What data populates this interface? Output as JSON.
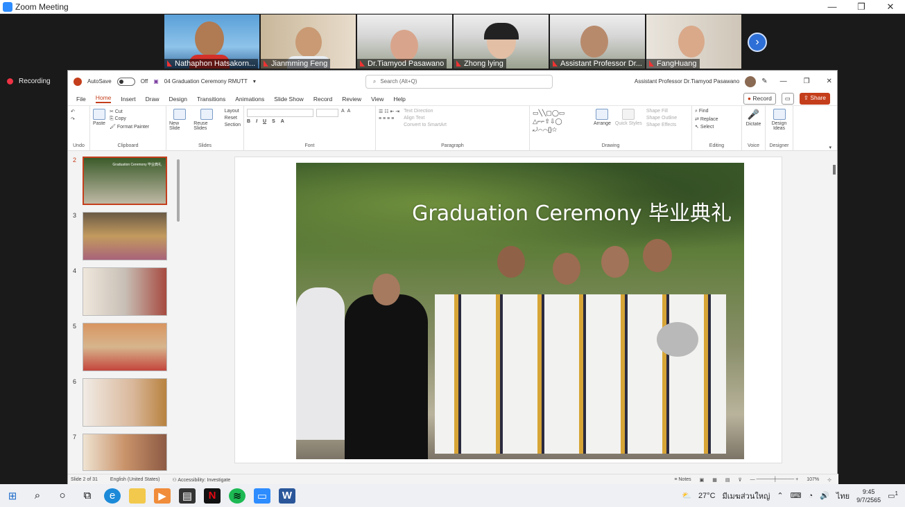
{
  "window": {
    "title": "Zoom Meeting",
    "controls": [
      "—",
      "❐",
      "✕"
    ]
  },
  "participants": [
    {
      "name": "Nathaphon Hatsakorn..."
    },
    {
      "name": "Jianmming Feng"
    },
    {
      "name": "Dr.Tiamyod Pasawano"
    },
    {
      "name": "Zhong lying"
    },
    {
      "name": "Assistant Professor Dr..."
    },
    {
      "name": "FangHuang"
    }
  ],
  "recording": {
    "label": "Recording"
  },
  "ppt": {
    "autosave": "AutoSave",
    "autosave_state": "Off",
    "filename": "04 Graduation Ceremony RMUTT",
    "search_placeholder": "Search (Alt+Q)",
    "user": "Assistant Professor Dr.Tiamyod Pasawano",
    "tabs": [
      "File",
      "Home",
      "Insert",
      "Draw",
      "Design",
      "Transitions",
      "Animations",
      "Slide Show",
      "Record",
      "Review",
      "View",
      "Help"
    ],
    "record_btn": "Record",
    "share_btn": "Share",
    "ribbon": {
      "cut": "Cut",
      "copy": "Copy",
      "format_painter": "Format Painter",
      "paste": "Paste",
      "new_slide": "New Slide",
      "reuse_slides": "Reuse Slides",
      "layout": "Layout",
      "reset": "Reset",
      "section": "Section",
      "text_direction": "Text Direction",
      "align_text": "Align Text",
      "convert_smartart": "Convert to SmartArt",
      "arrange": "Arrange",
      "quick_styles": "Quick Styles",
      "shape_fill": "Shape Fill",
      "shape_outline": "Shape Outline",
      "shape_effects": "Shape Effects",
      "find": "Find",
      "replace": "Replace",
      "select": "Select",
      "dictate": "Dictate",
      "design_ideas": "Design Ideas",
      "groups": {
        "undo": "Undo",
        "clipboard": "Clipboard",
        "slides": "Slides",
        "font": "Font",
        "paragraph": "Paragraph",
        "drawing": "Drawing",
        "editing": "Editing",
        "voice": "Voice",
        "designer": "Designer"
      }
    },
    "thumb_numbers": [
      "2",
      "3",
      "4",
      "5",
      "6",
      "7"
    ],
    "selected_thumb_title": "Graduation Ceremony 毕业典礼",
    "slide_title": "Graduation Ceremony 毕业典礼",
    "status": {
      "slide": "Slide 2 of 31",
      "language": "English (United States)",
      "accessibility": "Accessibility: Investigate",
      "notes": "Notes",
      "zoom": "107%"
    }
  },
  "taskbar": {
    "weather": "27°C",
    "location": "มีเมฆส่วนใหญ่",
    "lang": "ไทย",
    "time": "9:45",
    "date": "9/7/2565",
    "notif": "1"
  }
}
